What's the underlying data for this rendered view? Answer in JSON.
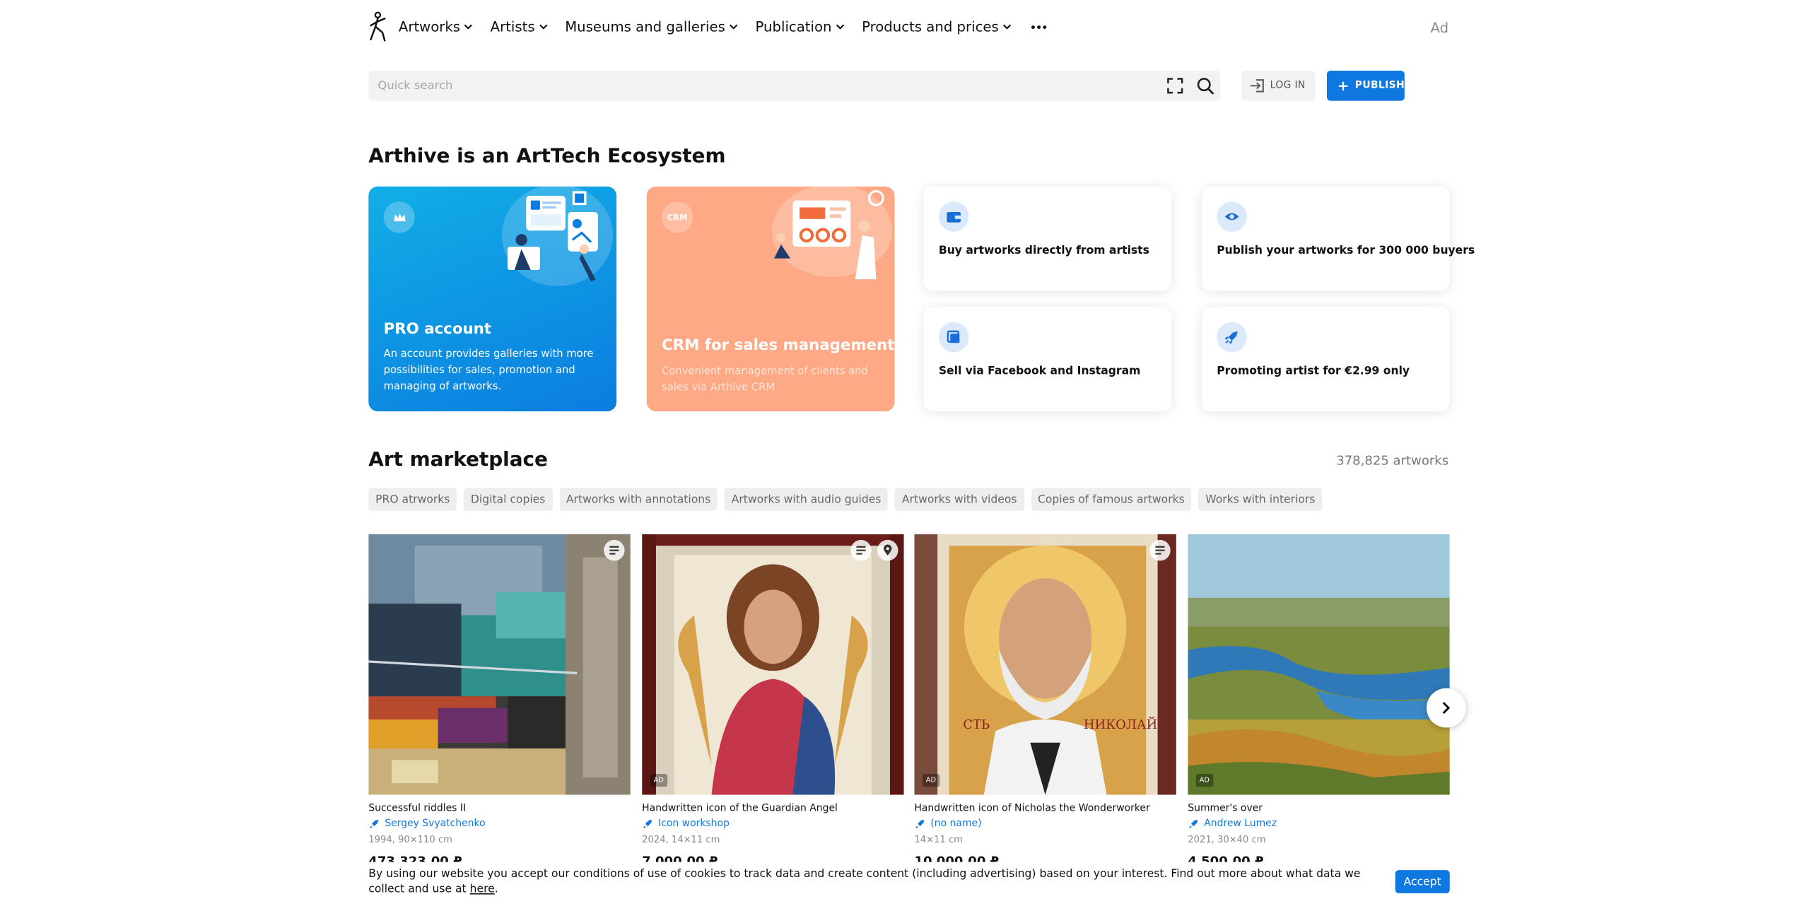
{
  "header": {
    "logo_icon": "arthive-logo-figure",
    "nav": [
      {
        "label": "Artworks"
      },
      {
        "label": "Artists"
      },
      {
        "label": "Museums and galleries"
      },
      {
        "label": "Publication"
      },
      {
        "label": "Products and prices"
      }
    ],
    "more_icon": "ellipsis-icon",
    "ad_label": "Ad"
  },
  "search": {
    "placeholder": "Quick search",
    "value": "",
    "expand_icon": "fullscreen-frame-icon",
    "search_icon": "magnifier-icon"
  },
  "auth": {
    "login_label": "LOG IN",
    "publish_label": "PUBLISH",
    "accent_color": "#0f78e0"
  },
  "ecosystem": {
    "title": "Arthive is an ArtTech Ecosystem",
    "cards": [
      {
        "title": "PRO account",
        "desc": "An account provides galleries with more possibilities for sales, promotion and managing of artworks.",
        "icon": "crown-icon",
        "color": "#0b8be0"
      },
      {
        "title": "CRM for sales management",
        "desc": "Convenient management of clients and sales via Arthive CRM",
        "badge": "CRM",
        "color": "#fda985"
      }
    ],
    "features": [
      {
        "label": "Buy artworks directly from artists",
        "icon": "wallet-icon"
      },
      {
        "label": "Publish your artworks for 300 000 buyers",
        "icon": "eye-icon"
      },
      {
        "label": "Sell via Facebook and Instagram",
        "icon": "share-icon"
      },
      {
        "label": "Promoting artist for €2.99 only",
        "icon": "rocket-icon"
      }
    ]
  },
  "marketplace": {
    "title": "Art marketplace",
    "count": "378,825 artworks",
    "filters": [
      "PRO atrworks",
      "Digital copies",
      "Artworks with annotations",
      "Artworks with audio guides",
      "Artworks with videos",
      "Copies of famous artworks",
      "Works with interiors"
    ],
    "artworks": [
      {
        "title": "Successful riddles II",
        "artist": "Sergey Svyatchenko",
        "meta": "1994, 90×110 cm",
        "price": "473 323,00 ₽",
        "ad": ""
      },
      {
        "title": "Handwritten icon of the Guardian Angel",
        "artist": "Icon workshop",
        "meta": "2024, 14×11 cm",
        "price": "7 000,00 ₽",
        "ad": "AD"
      },
      {
        "title": "Handwritten icon of Nicholas the Wonderworker",
        "artist": "(no name)",
        "meta": "14×11 cm",
        "price": "10 000,00 ₽",
        "ad": "AD"
      },
      {
        "title": "Summer's over",
        "artist": "Andrew Lumez",
        "meta": "2021, 30×40 cm",
        "price": "4 500,00 ₽",
        "ad": "AD"
      }
    ],
    "next_icon": "chevron-right-icon"
  },
  "cookie": {
    "text": "By using our website you accept our conditions of use of cookies to track data and create content (including advertising) based on your interest. Find out more about what data we collect and use at",
    "link": "here",
    "suffix": ".",
    "accept_label": "Accept"
  }
}
